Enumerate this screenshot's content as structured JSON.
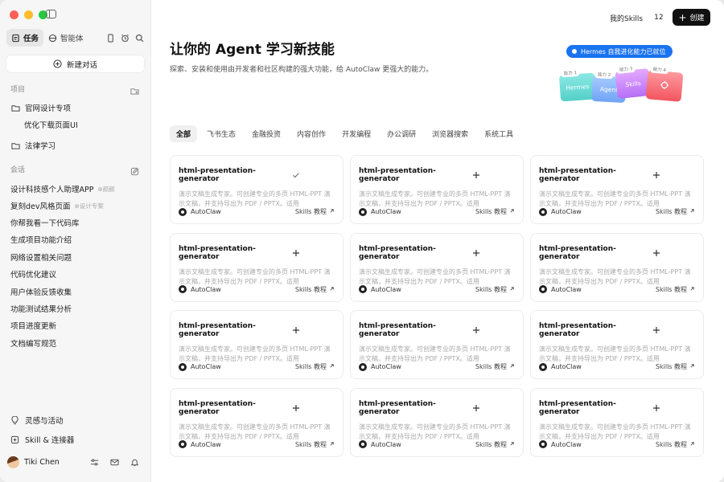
{
  "sidebar": {
    "tabs": [
      {
        "label": "任务",
        "icon": "tasks-icon",
        "active": true
      },
      {
        "label": "智能体",
        "icon": "agent-icon",
        "active": false
      }
    ],
    "new_chat_label": "新建对话",
    "projects_label": "项目",
    "projects": [
      {
        "label": "官网设计专项",
        "children": [
          "优化下载页面UI"
        ]
      },
      {
        "label": "法律学习",
        "children": []
      }
    ],
    "conversations_label": "会话",
    "conversations": [
      {
        "label": "设计科技感个人助理APP",
        "tag": "⊕颜颜"
      },
      {
        "label": "复刻dev风格页面",
        "tag": "⊕设计专案"
      },
      {
        "label": "你帮我看一下代码库",
        "tag": ""
      },
      {
        "label": "生成项目功能介绍",
        "tag": ""
      },
      {
        "label": "网络设置相关问题",
        "tag": ""
      },
      {
        "label": "代码优化建议",
        "tag": ""
      },
      {
        "label": "用户体验反馈收集",
        "tag": ""
      },
      {
        "label": "功能测试结果分析",
        "tag": ""
      },
      {
        "label": "项目进度更新",
        "tag": ""
      },
      {
        "label": "文档编写规范",
        "tag": ""
      }
    ],
    "bottom": [
      {
        "label": "灵感与活动",
        "icon": "bulb-icon"
      },
      {
        "label": "Skill & 连接器",
        "icon": "skill-icon"
      }
    ],
    "user": {
      "name": "Tiki Chen"
    }
  },
  "header": {
    "skills_label": "我的Skills",
    "skills_count": "12",
    "create_label": "创建"
  },
  "hero": {
    "title": "让你的 Agent 学习新技能",
    "subtitle": "探索、安装和使用由开发者和社区构建的强大功能，给 AutoClaw 更强大的能力。",
    "badge": "Hermes 自我进化能力已就位",
    "folders": [
      {
        "label": "Hermes",
        "tag": "能力 1"
      },
      {
        "label": "Agent",
        "tag": "能力 2"
      },
      {
        "label": "Skills",
        "tag": "能力 3"
      },
      {
        "label": "",
        "tag": "能力 4"
      }
    ]
  },
  "categories": [
    "全部",
    "飞书生态",
    "金融投资",
    "内容创作",
    "开发编程",
    "办公调研",
    "浏览器搜索",
    "系统工具"
  ],
  "cards": [
    {
      "title": "html-presentation-generator",
      "desc": "演示文稿生成专家。可创建专业的多页 HTML-PPT 演示文稿，并支持导出为 PDF / PPTX。适用",
      "brand": "AutoClaw",
      "link": "Skills 教程",
      "installed": true
    },
    {
      "title": "html-presentation-generator",
      "desc": "演示文稿生成专家。可创建专业的多页 HTML-PPT 演示文稿，并支持导出为 PDF / PPTX。适用",
      "brand": "AutoClaw",
      "link": "Skills 教程",
      "installed": false
    },
    {
      "title": "html-presentation-generator",
      "desc": "演示文稿生成专家。可创建专业的多页 HTML-PPT 演示文稿，并支持导出为 PDF / PPTX。适用",
      "brand": "AutoClaw",
      "link": "Skills 教程",
      "installed": false
    },
    {
      "title": "html-presentation-generator",
      "desc": "演示文稿生成专家。可创建专业的多页 HTML-PPT 演示文稿，并支持导出为 PDF / PPTX。适用",
      "brand": "AutoClaw",
      "link": "Skills 教程",
      "installed": false
    },
    {
      "title": "html-presentation-generator",
      "desc": "演示文稿生成专家。可创建专业的多页 HTML-PPT 演示文稿，并支持导出为 PDF / PPTX。适用",
      "brand": "AutoClaw",
      "link": "Skills 教程",
      "installed": false
    },
    {
      "title": "html-presentation-generator",
      "desc": "演示文稿生成专家。可创建专业的多页 HTML-PPT 演示文稿，并支持导出为 PDF / PPTX。适用",
      "brand": "AutoClaw",
      "link": "Skills 教程",
      "installed": false
    },
    {
      "title": "html-presentation-generator",
      "desc": "演示文稿生成专家。可创建专业的多页 HTML-PPT 演示文稿，并支持导出为 PDF / PPTX。适用",
      "brand": "AutoClaw",
      "link": "Skills 教程",
      "installed": false
    },
    {
      "title": "html-presentation-generator",
      "desc": "演示文稿生成专家。可创建专业的多页 HTML-PPT 演示文稿，并支持导出为 PDF / PPTX。适用",
      "brand": "AutoClaw",
      "link": "Skills 教程",
      "installed": false
    },
    {
      "title": "html-presentation-generator",
      "desc": "演示文稿生成专家。可创建专业的多页 HTML-PPT 演示文稿，并支持导出为 PDF / PPTX。适用",
      "brand": "AutoClaw",
      "link": "Skills 教程",
      "installed": false
    },
    {
      "title": "html-presentation-generator",
      "desc": "演示文稿生成专家。可创建专业的多页 HTML-PPT 演示文稿，并支持导出为 PDF / PPTX。适用",
      "brand": "AutoClaw",
      "link": "Skills 教程",
      "installed": false
    },
    {
      "title": "html-presentation-generator",
      "desc": "演示文稿生成专家。可创建专业的多页 HTML-PPT 演示文稿，并支持导出为 PDF / PPTX。适用",
      "brand": "AutoClaw",
      "link": "Skills 教程",
      "installed": false
    },
    {
      "title": "html-presentation-generator",
      "desc": "演示文稿生成专家。可创建专业的多页 HTML-PPT 演示文稿，并支持导出为 PDF / PPTX。适用",
      "brand": "AutoClaw",
      "link": "Skills 教程",
      "installed": false
    }
  ],
  "colors": {
    "accent": "#1a73f0",
    "primary_button": "#111111"
  }
}
